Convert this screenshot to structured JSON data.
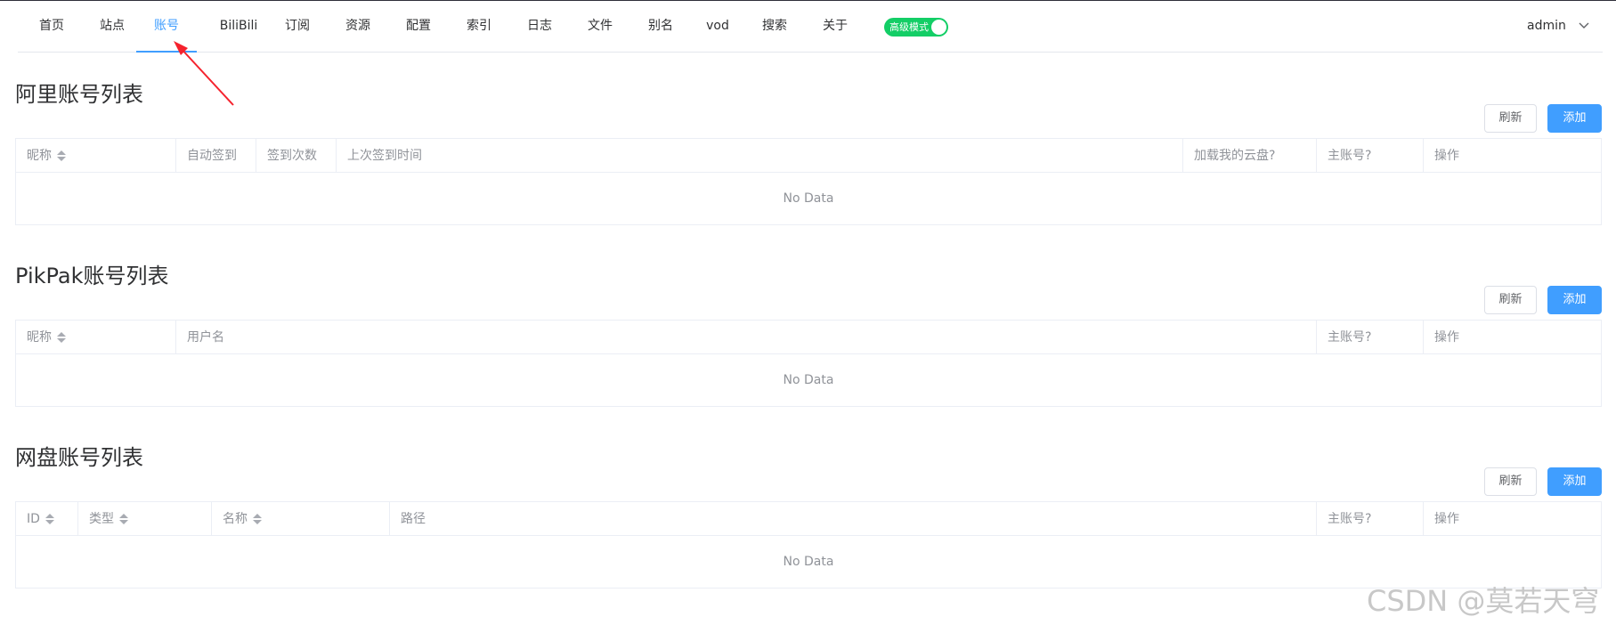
{
  "nav": {
    "items": [
      {
        "label": "首页",
        "active": false
      },
      {
        "label": "站点",
        "active": false
      },
      {
        "label": "账号",
        "active": true
      },
      {
        "label": "BiliBili",
        "active": false
      },
      {
        "label": "订阅",
        "active": false
      },
      {
        "label": "资源",
        "active": false
      },
      {
        "label": "配置",
        "active": false
      },
      {
        "label": "索引",
        "active": false
      },
      {
        "label": "日志",
        "active": false
      },
      {
        "label": "文件",
        "active": false
      },
      {
        "label": "别名",
        "active": false
      },
      {
        "label": "vod",
        "active": false
      },
      {
        "label": "搜索",
        "active": false
      },
      {
        "label": "关于",
        "active": false
      }
    ],
    "advanced_mode": {
      "label": "高级模式",
      "enabled": true
    },
    "user": {
      "name": "admin",
      "icon": "chevron-down-icon"
    }
  },
  "sections": [
    {
      "title": "阿里账号列表",
      "refresh_label": "刷新",
      "add_label": "添加",
      "columns": [
        {
          "label": "昵称",
          "sortable": true
        },
        {
          "label": "自动签到",
          "sortable": false
        },
        {
          "label": "签到次数",
          "sortable": false
        },
        {
          "label": "上次签到时间",
          "sortable": false
        },
        {
          "label": "加载我的云盘?",
          "sortable": false
        },
        {
          "label": "主账号?",
          "sortable": false
        },
        {
          "label": "操作",
          "sortable": false
        }
      ],
      "empty_text": "No Data"
    },
    {
      "title": "PikPak账号列表",
      "refresh_label": "刷新",
      "add_label": "添加",
      "columns": [
        {
          "label": "昵称",
          "sortable": true
        },
        {
          "label": "用户名",
          "sortable": false
        },
        {
          "label": "主账号?",
          "sortable": false
        },
        {
          "label": "操作",
          "sortable": false
        }
      ],
      "empty_text": "No Data"
    },
    {
      "title": "网盘账号列表",
      "refresh_label": "刷新",
      "add_label": "添加",
      "columns": [
        {
          "label": "ID",
          "sortable": true
        },
        {
          "label": "类型",
          "sortable": true
        },
        {
          "label": "名称",
          "sortable": true
        },
        {
          "label": "路径",
          "sortable": false
        },
        {
          "label": "主账号?",
          "sortable": false
        },
        {
          "label": "操作",
          "sortable": false
        }
      ],
      "empty_text": "No Data"
    }
  ],
  "colors": {
    "accent": "#409eff",
    "toggle_on": "#13ce66",
    "arrow": "#f5222d"
  },
  "watermark": "CSDN @莫若天穹"
}
